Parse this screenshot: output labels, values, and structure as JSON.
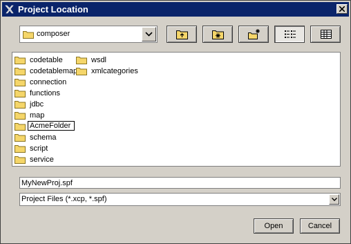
{
  "window": {
    "title": "Project Location"
  },
  "location": {
    "current_folder": "composer"
  },
  "toolbar": {
    "buttons": [
      {
        "icon": "up-folder-icon"
      },
      {
        "icon": "home-folder-icon"
      },
      {
        "icon": "new-folder-icon"
      },
      {
        "icon": "list-view-icon",
        "pressed": true
      },
      {
        "icon": "details-view-icon"
      }
    ]
  },
  "files": {
    "items": [
      {
        "name": "codetable"
      },
      {
        "name": "codetablemap"
      },
      {
        "name": "connection"
      },
      {
        "name": "functions"
      },
      {
        "name": "jdbc"
      },
      {
        "name": "map"
      },
      {
        "name": "AcmeFolder",
        "editing": true
      },
      {
        "name": "schema"
      },
      {
        "name": "script"
      },
      {
        "name": "service"
      },
      {
        "name": "wsdl"
      },
      {
        "name": "xmlcategories"
      }
    ]
  },
  "filename": {
    "value": "MyNewProj.spf"
  },
  "filetype": {
    "selected": "Project Files (*.xcp, *.spf)"
  },
  "buttons": {
    "open_label": "Open",
    "cancel_label": "Cancel"
  },
  "colors": {
    "titlebar": "#0a246a",
    "face": "#d4d0c8",
    "folder": "#f5d66a"
  }
}
